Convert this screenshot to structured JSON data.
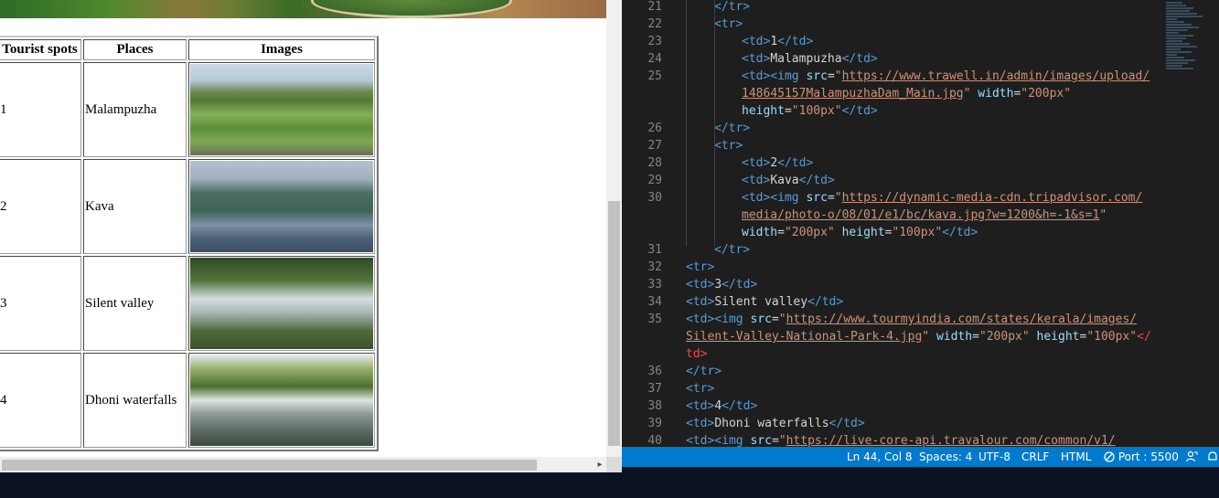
{
  "table": {
    "headers": [
      "Tourist spots",
      "Places",
      "Images"
    ],
    "rows": [
      {
        "num": "1",
        "place": "Malampuzha",
        "image": "malampuzha-dam-garden-photo"
      },
      {
        "num": "2",
        "place": "Kava",
        "image": "kava-lake-hills-photo"
      },
      {
        "num": "3",
        "place": "Silent valley",
        "image": "silent-valley-gate-photo"
      },
      {
        "num": "4",
        "place": "Dhoni waterfalls",
        "image": "dhoni-waterfalls-photo"
      }
    ]
  },
  "editor": {
    "lines": [
      {
        "n": "21",
        "indent": 1,
        "parts": [
          [
            "tag",
            "</tr>"
          ]
        ]
      },
      {
        "n": "22",
        "indent": 1,
        "parts": [
          [
            "tag",
            "<tr>"
          ]
        ]
      },
      {
        "n": "23",
        "indent": 2,
        "parts": [
          [
            "tag",
            "<td>"
          ],
          [
            "txt",
            "1"
          ],
          [
            "tag",
            "</td>"
          ]
        ]
      },
      {
        "n": "24",
        "indent": 2,
        "parts": [
          [
            "tag",
            "<td>"
          ],
          [
            "txt",
            "Malampuzha"
          ],
          [
            "tag",
            "</td>"
          ]
        ]
      },
      {
        "n": "25",
        "indent": 2,
        "parts": [
          [
            "tag",
            "<td><img "
          ],
          [
            "attr",
            "src"
          ],
          [
            "txt",
            "="
          ],
          [
            "str",
            "\""
          ],
          [
            "url",
            "https://www.trawell.in/admin/images/upload/"
          ]
        ]
      },
      {
        "n": "",
        "indent": 2,
        "parts": [
          [
            "url",
            "148645157MalampuzhaDam_Main.jpg"
          ],
          [
            "str",
            "\""
          ],
          [
            "txt",
            " "
          ],
          [
            "attr",
            "width"
          ],
          [
            "txt",
            "="
          ],
          [
            "str",
            "\"200px\""
          ]
        ]
      },
      {
        "n": "",
        "indent": 2,
        "parts": [
          [
            "attr",
            "height"
          ],
          [
            "txt",
            "="
          ],
          [
            "str",
            "\"100px\""
          ],
          [
            "tag",
            "</td>"
          ]
        ]
      },
      {
        "n": "26",
        "indent": 1,
        "parts": [
          [
            "tag",
            "</tr>"
          ]
        ]
      },
      {
        "n": "27",
        "indent": 1,
        "parts": [
          [
            "tag",
            "<tr>"
          ]
        ]
      },
      {
        "n": "28",
        "indent": 2,
        "parts": [
          [
            "tag",
            "<td>"
          ],
          [
            "txt",
            "2"
          ],
          [
            "tag",
            "</td>"
          ]
        ]
      },
      {
        "n": "29",
        "indent": 2,
        "parts": [
          [
            "tag",
            "<td>"
          ],
          [
            "txt",
            "Kava"
          ],
          [
            "tag",
            "</td>"
          ]
        ]
      },
      {
        "n": "30",
        "indent": 2,
        "parts": [
          [
            "tag",
            "<td><img "
          ],
          [
            "attr",
            "src"
          ],
          [
            "txt",
            "="
          ],
          [
            "str",
            "\""
          ],
          [
            "url",
            "https://dynamic-media-cdn.tripadvisor.com/"
          ]
        ]
      },
      {
        "n": "",
        "indent": 2,
        "parts": [
          [
            "url",
            "media/photo-o/08/01/e1/bc/kava.jpg?w=1200&h=-1&s=1"
          ],
          [
            "str",
            "\""
          ]
        ]
      },
      {
        "n": "",
        "indent": 2,
        "parts": [
          [
            "attr",
            "width"
          ],
          [
            "txt",
            "="
          ],
          [
            "str",
            "\"200px\""
          ],
          [
            "txt",
            " "
          ],
          [
            "attr",
            "height"
          ],
          [
            "txt",
            "="
          ],
          [
            "str",
            "\"100px\""
          ],
          [
            "tag",
            "</td>"
          ]
        ]
      },
      {
        "n": "31",
        "indent": 1,
        "parts": [
          [
            "tag",
            "</tr>"
          ]
        ]
      },
      {
        "n": "32",
        "indent": 0,
        "parts": [
          [
            "tag",
            "<tr>"
          ]
        ]
      },
      {
        "n": "33",
        "indent": 0,
        "parts": [
          [
            "tag",
            "<td>"
          ],
          [
            "txt",
            "3"
          ],
          [
            "tag",
            "</td>"
          ]
        ]
      },
      {
        "n": "34",
        "indent": 0,
        "parts": [
          [
            "tag",
            "<td>"
          ],
          [
            "txt",
            "Silent valley"
          ],
          [
            "tag",
            "</td>"
          ]
        ]
      },
      {
        "n": "35",
        "indent": 0,
        "parts": [
          [
            "tag",
            "<td><img "
          ],
          [
            "attr",
            "src"
          ],
          [
            "txt",
            "="
          ],
          [
            "str",
            "\""
          ],
          [
            "url",
            "https://www.tourmyindia.com/states/kerala/images/"
          ]
        ]
      },
      {
        "n": "",
        "indent": 0,
        "parts": [
          [
            "url",
            "Silent-Valley-National-Park-4.jpg"
          ],
          [
            "str",
            "\""
          ],
          [
            "txt",
            " "
          ],
          [
            "attr",
            "width"
          ],
          [
            "txt",
            "="
          ],
          [
            "str",
            "\"200px\""
          ],
          [
            "txt",
            " "
          ],
          [
            "attr",
            "height"
          ],
          [
            "txt",
            "="
          ],
          [
            "str",
            "\"100px\""
          ],
          [
            "err",
            "</"
          ]
        ]
      },
      {
        "n": "",
        "indent": 0,
        "parts": [
          [
            "err",
            "td>"
          ]
        ]
      },
      {
        "n": "36",
        "indent": 0,
        "parts": [
          [
            "tag",
            "</tr>"
          ]
        ]
      },
      {
        "n": "37",
        "indent": 0,
        "parts": [
          [
            "tag",
            "<tr>"
          ]
        ]
      },
      {
        "n": "38",
        "indent": 0,
        "parts": [
          [
            "tag",
            "<td>"
          ],
          [
            "txt",
            "4"
          ],
          [
            "tag",
            "</td>"
          ]
        ]
      },
      {
        "n": "39",
        "indent": 0,
        "parts": [
          [
            "tag",
            "<td>"
          ],
          [
            "txt",
            "Dhoni waterfalls"
          ],
          [
            "tag",
            "</td>"
          ]
        ]
      },
      {
        "n": "40",
        "indent": 0,
        "parts": [
          [
            "tag",
            "<td><img "
          ],
          [
            "attr",
            "src"
          ],
          [
            "txt",
            "="
          ],
          [
            "str",
            "\""
          ],
          [
            "url",
            "https://live-core-api.travalour.com/common/v1/"
          ]
        ]
      }
    ]
  },
  "statusbar": {
    "position": "Ln 44, Col 8",
    "spaces": "Spaces: 4",
    "encoding": "UTF-8",
    "eol": "CRLF",
    "language": "HTML",
    "port": "Port : 5500"
  },
  "colors": {
    "statusbar": "#007acc",
    "editor_bg": "#1e1e1e",
    "tag": "#569cd6",
    "attr": "#9cdcfe",
    "string": "#ce9178"
  }
}
